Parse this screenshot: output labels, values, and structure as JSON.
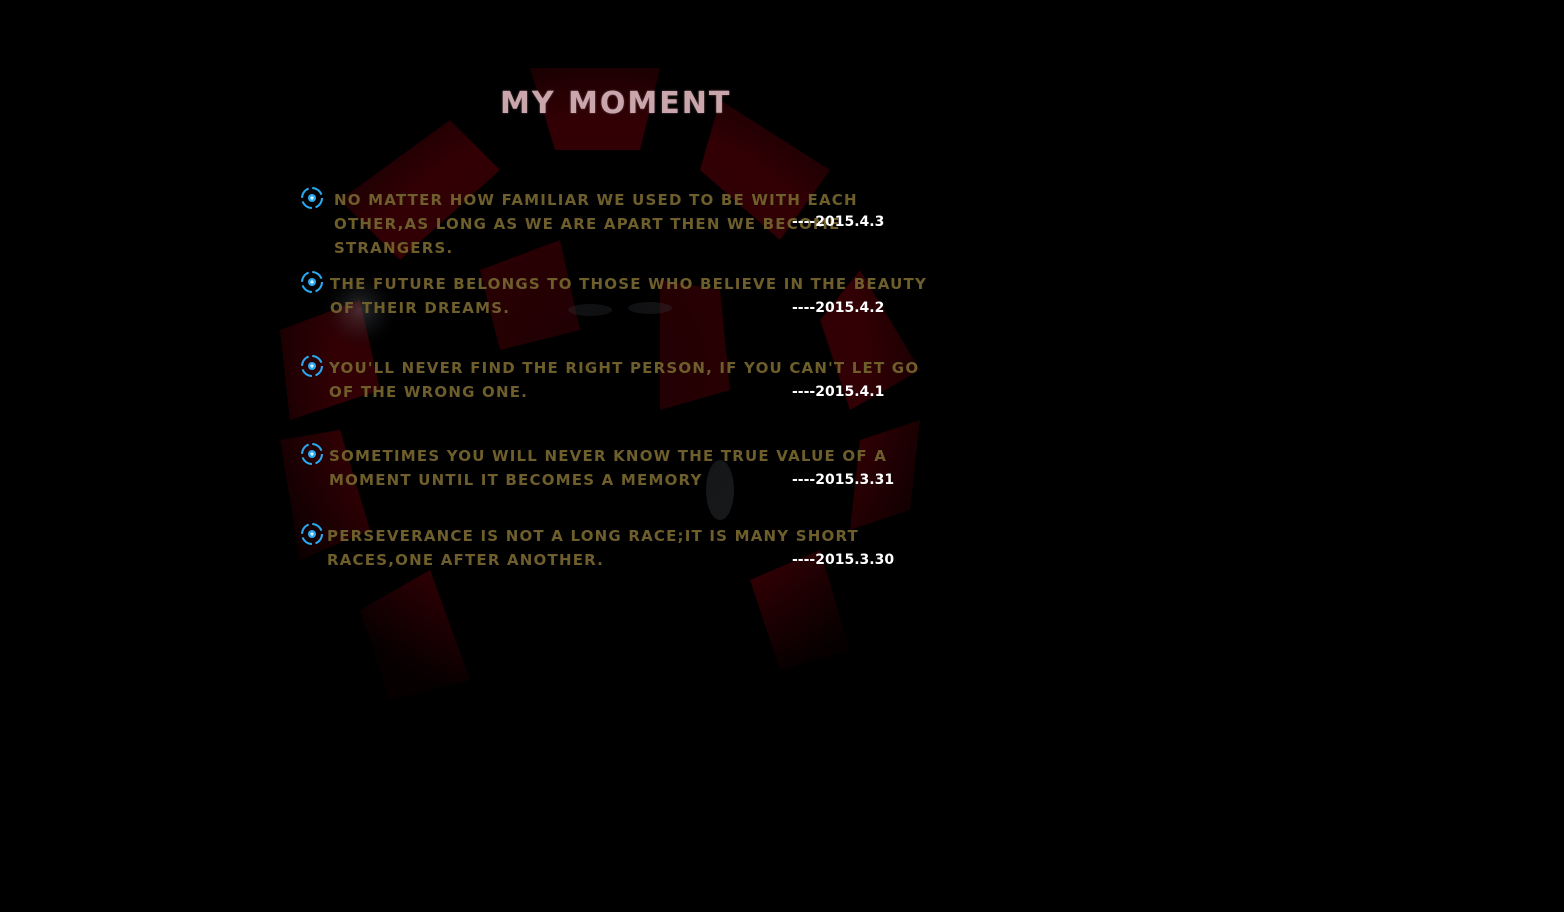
{
  "page": {
    "title": "MY MOMENT"
  },
  "colors": {
    "background": "#000000",
    "title": "#c8a6ab",
    "quote_text": "#6e5e2c",
    "date_text": "#ffffff",
    "bullet_icon": "#2aa8f0",
    "bg_art": "#5a0008"
  },
  "moments": [
    {
      "text": "No matter how familiar we used to be with each other,as long as we are apart then we become strangers.",
      "date": "----2015.4.3",
      "icon": "target-bullet-icon"
    },
    {
      "text": "The future belongs to those who believe in the beauty of their dreams.",
      "date": "----2015.4.2",
      "icon": "target-bullet-icon"
    },
    {
      "text": "You'll never find the right person, if you can't let go of the wrong one.",
      "date": "----2015.4.1",
      "icon": "target-bullet-icon"
    },
    {
      "text": "Sometimes you will never know the true value of a moment until it becomes a memory",
      "date": "----2015.3.31",
      "icon": "target-bullet-icon"
    },
    {
      "text": "Perseverance is not a long race;it is many short races,one after another.",
      "date": "----2015.3.30",
      "icon": "target-bullet-icon"
    }
  ]
}
